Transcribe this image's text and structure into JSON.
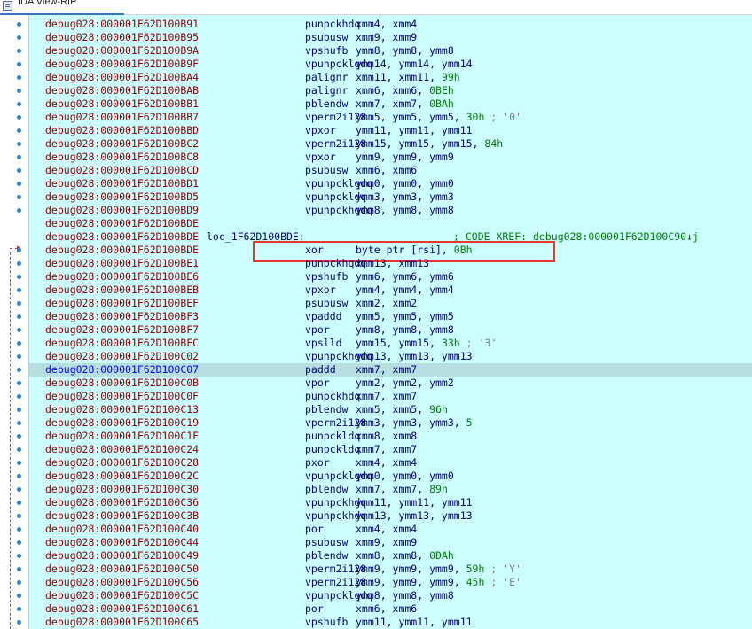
{
  "window": {
    "title": "IDA View-RIP"
  },
  "colors": {
    "background": "#ccffff",
    "address": "#8b0000",
    "code": "#000080",
    "number": "#008000",
    "highlight": "#e8392a"
  },
  "lines": [
    {
      "addr": "debug028:000001F62D100B91",
      "mnem": "punpckhdq",
      "ops": "xmm4, xmm4"
    },
    {
      "addr": "debug028:000001F62D100B95",
      "mnem": "psubusw",
      "ops": "xmm9, xmm9"
    },
    {
      "addr": "debug028:000001F62D100B9A",
      "mnem": "vpshufb",
      "ops": "ymm8, ymm8, ymm8"
    },
    {
      "addr": "debug028:000001F62D100B9F",
      "mnem": "vpunpcklqdq",
      "ops": "ymm14, ymm14, ymm14"
    },
    {
      "addr": "debug028:000001F62D100BA4",
      "mnem": "palignr",
      "ops": "xmm11, xmm11, ",
      "num": "99h"
    },
    {
      "addr": "debug028:000001F62D100BAB",
      "mnem": "palignr",
      "ops": "xmm6, xmm6, ",
      "num": "0BEh"
    },
    {
      "addr": "debug028:000001F62D100BB1",
      "mnem": "pblendw",
      "ops": "xmm7, xmm7, ",
      "num": "0BAh"
    },
    {
      "addr": "debug028:000001F62D100BB7",
      "mnem": "vperm2i128",
      "ops": "ymm5, ymm5, ymm5, ",
      "num": "30h",
      "cmt": " ; '0'"
    },
    {
      "addr": "debug028:000001F62D100BBD",
      "mnem": "vpxor",
      "ops": "ymm11, ymm11, ymm11"
    },
    {
      "addr": "debug028:000001F62D100BC2",
      "mnem": "vperm2i128",
      "ops": "ymm15, ymm15, ymm15, ",
      "num": "84h"
    },
    {
      "addr": "debug028:000001F62D100BC8",
      "mnem": "vpxor",
      "ops": "ymm9, ymm9, ymm9"
    },
    {
      "addr": "debug028:000001F62D100BCD",
      "mnem": "psubusw",
      "ops": "xmm6, xmm6"
    },
    {
      "addr": "debug028:000001F62D100BD1",
      "mnem": "vpunpcklqdq",
      "ops": "ymm0, ymm0, ymm0"
    },
    {
      "addr": "debug028:000001F62D100BD5",
      "mnem": "vpunpckldq",
      "ops": "ymm3, ymm3, ymm3"
    },
    {
      "addr": "debug028:000001F62D100BD9",
      "mnem": "vpunpckhqdq",
      "ops": "ymm8, ymm8, ymm8"
    },
    {
      "addr": "debug028:000001F62D100BDE",
      "mnem": "",
      "ops": ""
    },
    {
      "addr": "debug028:000001F62D100BDE",
      "label": "loc_1F62D100BDE:",
      "xref": "; CODE XREF: debug028:000001F62D100C90↓j"
    },
    {
      "addr": "debug028:000001F62D100BDE",
      "mnem": "xor",
      "ops": "byte ptr [rsi], ",
      "num": "0Bh"
    },
    {
      "addr": "debug028:000001F62D100BE1",
      "mnem": "punpckhqdq",
      "ops": "xmm13, xmm13"
    },
    {
      "addr": "debug028:000001F62D100BE6",
      "mnem": "vpshufb",
      "ops": "ymm6, ymm6, ymm6"
    },
    {
      "addr": "debug028:000001F62D100BEB",
      "mnem": "vpxor",
      "ops": "ymm4, ymm4, ymm4"
    },
    {
      "addr": "debug028:000001F62D100BEF",
      "mnem": "psubusw",
      "ops": "xmm2, xmm2"
    },
    {
      "addr": "debug028:000001F62D100BF3",
      "mnem": "vpaddd",
      "ops": "ymm5, ymm5, ymm5"
    },
    {
      "addr": "debug028:000001F62D100BF7",
      "mnem": "vpor",
      "ops": "ymm8, ymm8, ymm8"
    },
    {
      "addr": "debug028:000001F62D100BFC",
      "mnem": "vpslld",
      "ops": "ymm15, ymm15, ",
      "num": "33h",
      "cmt": " ; '3'"
    },
    {
      "addr": "debug028:000001F62D100C02",
      "mnem": "vpunpckhqdq",
      "ops": "ymm13, ymm13, ymm13"
    },
    {
      "addr": "debug028:000001F62D100C07",
      "mnem": "paddd",
      "ops": "xmm7, xmm7",
      "selected": true
    },
    {
      "addr": "debug028:000001F62D100C0B",
      "mnem": "vpor",
      "ops": "ymm2, ymm2, ymm2"
    },
    {
      "addr": "debug028:000001F62D100C0F",
      "mnem": "punpckhdq",
      "ops": "xmm7, xmm7"
    },
    {
      "addr": "debug028:000001F62D100C13",
      "mnem": "pblendw",
      "ops": "xmm5, xmm5, ",
      "num": "96h"
    },
    {
      "addr": "debug028:000001F62D100C19",
      "mnem": "vperm2i128",
      "ops": "ymm3, ymm3, ymm3, ",
      "num": "5"
    },
    {
      "addr": "debug028:000001F62D100C1F",
      "mnem": "punpckldq",
      "ops": "xmm8, xmm8"
    },
    {
      "addr": "debug028:000001F62D100C24",
      "mnem": "punpckldq",
      "ops": "xmm7, xmm7"
    },
    {
      "addr": "debug028:000001F62D100C28",
      "mnem": "pxor",
      "ops": "xmm4, xmm4"
    },
    {
      "addr": "debug028:000001F62D100C2C",
      "mnem": "vpunpcklqdq",
      "ops": "ymm0, ymm0, ymm0"
    },
    {
      "addr": "debug028:000001F62D100C30",
      "mnem": "pblendw",
      "ops": "xmm7, xmm7, ",
      "num": "89h"
    },
    {
      "addr": "debug028:000001F62D100C36",
      "mnem": "vpunpckhdq",
      "ops": "ymm11, ymm11, ymm11"
    },
    {
      "addr": "debug028:000001F62D100C3B",
      "mnem": "vpunpckhdq",
      "ops": "ymm13, ymm13, ymm13"
    },
    {
      "addr": "debug028:000001F62D100C40",
      "mnem": "por",
      "ops": "xmm4, xmm4"
    },
    {
      "addr": "debug028:000001F62D100C44",
      "mnem": "psubusw",
      "ops": "xmm9, xmm9"
    },
    {
      "addr": "debug028:000001F62D100C49",
      "mnem": "pblendw",
      "ops": "xmm8, xmm8, ",
      "num": "0DAh"
    },
    {
      "addr": "debug028:000001F62D100C50",
      "mnem": "vperm2i128",
      "ops": "ymm9, ymm9, ymm9, ",
      "num": "59h",
      "cmt": " ; 'Y'"
    },
    {
      "addr": "debug028:000001F62D100C56",
      "mnem": "vperm2i128",
      "ops": "ymm9, ymm9, ymm9, ",
      "num": "45h",
      "cmt": " ; 'E'"
    },
    {
      "addr": "debug028:000001F62D100C5C",
      "mnem": "vpunpcklqdq",
      "ops": "ymm8, ymm8, ymm8"
    },
    {
      "addr": "debug028:000001F62D100C61",
      "mnem": "por",
      "ops": "xmm6, xmm6"
    },
    {
      "addr": "debug028:000001F62D100C65",
      "mnem": "vpshufb",
      "ops": "ymm11, ymm11, ymm11"
    }
  ]
}
